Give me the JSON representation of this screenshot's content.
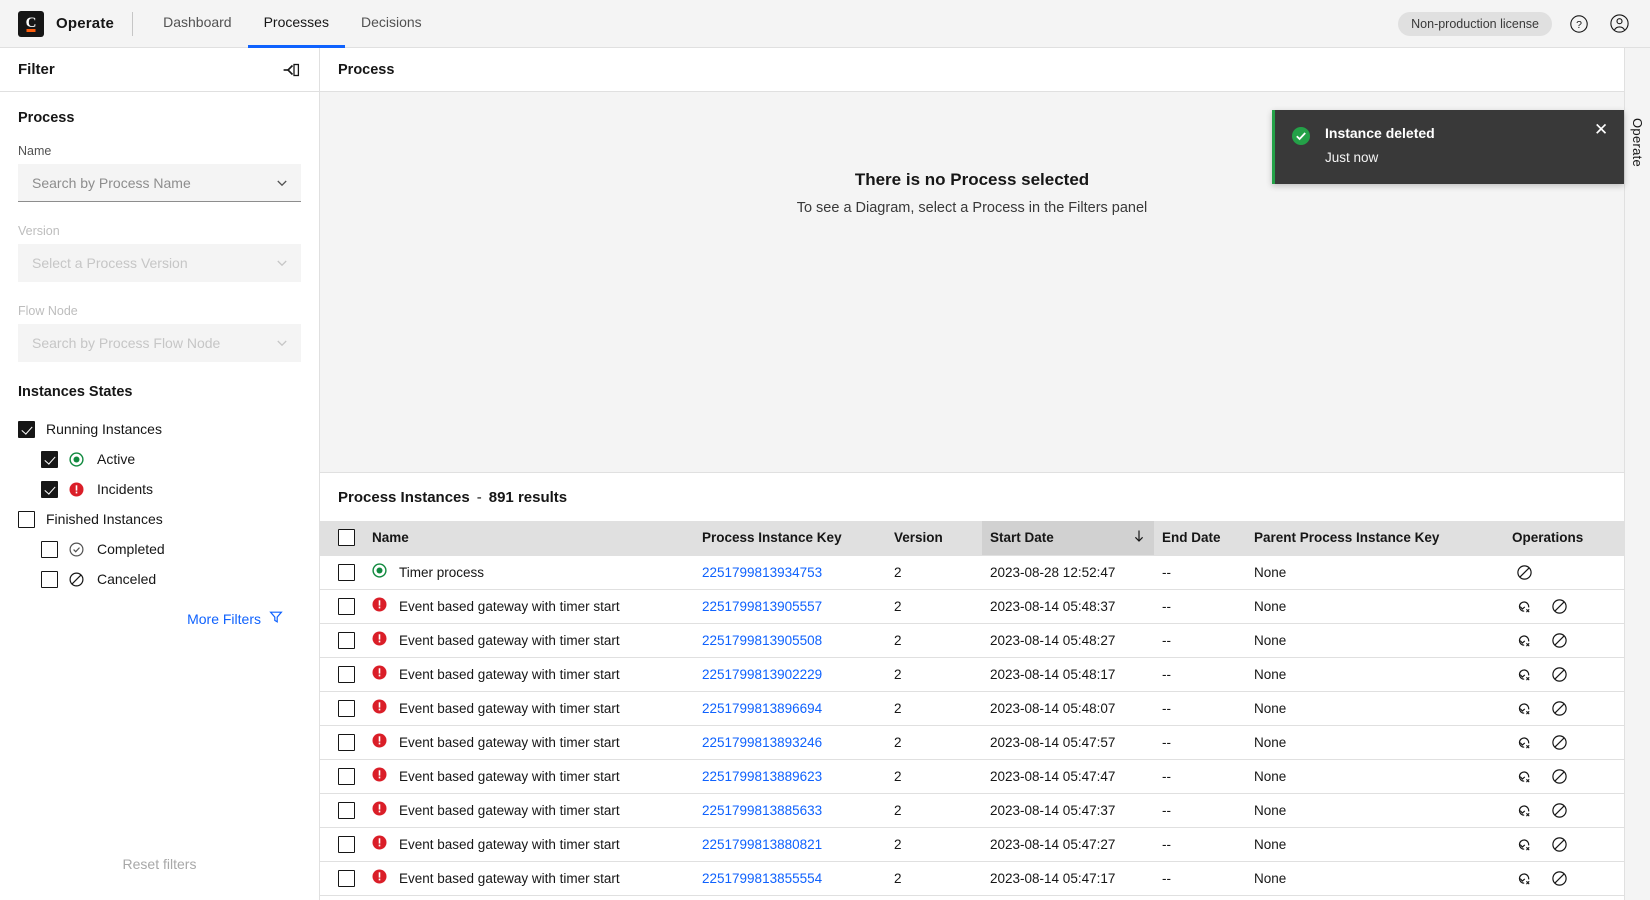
{
  "topnav": {
    "brand": "Operate",
    "logo_letter": "C",
    "tabs": [
      {
        "label": "Dashboard",
        "active": false
      },
      {
        "label": "Processes",
        "active": true
      },
      {
        "label": "Decisions",
        "active": false
      }
    ],
    "license_badge": "Non-production license",
    "help_icon": "help-circle-icon",
    "user_icon": "user-avatar-icon"
  },
  "sidebar": {
    "title": "Filter",
    "collapse_icon": "collapse-panel-icon",
    "process_section_title": "Process",
    "fields": {
      "name_label": "Name",
      "name_placeholder": "Search by Process Name",
      "version_label": "Version",
      "version_placeholder": "Select a Process Version",
      "flownode_label": "Flow Node",
      "flownode_placeholder": "Search by Process Flow Node"
    },
    "states_title": "Instances States",
    "states": [
      {
        "label": "Running Instances",
        "checked": true,
        "indent": false,
        "icon": ""
      },
      {
        "label": "Active",
        "checked": true,
        "indent": true,
        "icon": "active-icon"
      },
      {
        "label": "Incidents",
        "checked": true,
        "indent": true,
        "icon": "incident-icon"
      },
      {
        "label": "Finished Instances",
        "checked": false,
        "indent": false,
        "icon": ""
      },
      {
        "label": "Completed",
        "checked": false,
        "indent": true,
        "icon": "completed-icon"
      },
      {
        "label": "Canceled",
        "checked": false,
        "indent": true,
        "icon": "canceled-icon"
      }
    ],
    "more_filters": "More Filters",
    "more_filters_icon": "filter-funnel-icon",
    "reset_filters": "Reset filters"
  },
  "diagram": {
    "panel_title": "Process",
    "empty_title": "There is no Process selected",
    "empty_sub": "To see a Diagram, select a Process in the Filters panel"
  },
  "list": {
    "title": "Process Instances",
    "separator": "-",
    "count_label": "891 results",
    "columns": [
      "Name",
      "Process Instance Key",
      "Version",
      "Start Date",
      "End Date",
      "Parent Process Instance Key",
      "Operations"
    ],
    "sorted_column": "Start Date",
    "sort_direction_icon": "arrow-down-icon",
    "rows": [
      {
        "state": "active",
        "name": "Timer process",
        "key": "2251799813934753",
        "version": "2",
        "start": "2023-08-28 12:52:47",
        "end": "--",
        "parent": "None",
        "ops": [
          "cancel-icon"
        ]
      },
      {
        "state": "incident",
        "name": "Event based gateway with timer start",
        "key": "2251799813905557",
        "version": "2",
        "start": "2023-08-14 05:48:37",
        "end": "--",
        "parent": "None",
        "ops": [
          "retry-icon",
          "cancel-icon"
        ]
      },
      {
        "state": "incident",
        "name": "Event based gateway with timer start",
        "key": "2251799813905508",
        "version": "2",
        "start": "2023-08-14 05:48:27",
        "end": "--",
        "parent": "None",
        "ops": [
          "retry-icon",
          "cancel-icon"
        ]
      },
      {
        "state": "incident",
        "name": "Event based gateway with timer start",
        "key": "2251799813902229",
        "version": "2",
        "start": "2023-08-14 05:48:17",
        "end": "--",
        "parent": "None",
        "ops": [
          "retry-icon",
          "cancel-icon"
        ]
      },
      {
        "state": "incident",
        "name": "Event based gateway with timer start",
        "key": "2251799813896694",
        "version": "2",
        "start": "2023-08-14 05:48:07",
        "end": "--",
        "parent": "None",
        "ops": [
          "retry-icon",
          "cancel-icon"
        ]
      },
      {
        "state": "incident",
        "name": "Event based gateway with timer start",
        "key": "2251799813893246",
        "version": "2",
        "start": "2023-08-14 05:47:57",
        "end": "--",
        "parent": "None",
        "ops": [
          "retry-icon",
          "cancel-icon"
        ]
      },
      {
        "state": "incident",
        "name": "Event based gateway with timer start",
        "key": "2251799813889623",
        "version": "2",
        "start": "2023-08-14 05:47:47",
        "end": "--",
        "parent": "None",
        "ops": [
          "retry-icon",
          "cancel-icon"
        ]
      },
      {
        "state": "incident",
        "name": "Event based gateway with timer start",
        "key": "2251799813885633",
        "version": "2",
        "start": "2023-08-14 05:47:37",
        "end": "--",
        "parent": "None",
        "ops": [
          "retry-icon",
          "cancel-icon"
        ]
      },
      {
        "state": "incident",
        "name": "Event based gateway with timer start",
        "key": "2251799813880821",
        "version": "2",
        "start": "2023-08-14 05:47:27",
        "end": "--",
        "parent": "None",
        "ops": [
          "retry-icon",
          "cancel-icon"
        ]
      },
      {
        "state": "incident",
        "name": "Event based gateway with timer start",
        "key": "2251799813855554",
        "version": "2",
        "start": "2023-08-14 05:47:17",
        "end": "--",
        "parent": "None",
        "ops": [
          "retry-icon",
          "cancel-icon"
        ]
      }
    ]
  },
  "right_rail": {
    "label": "Operate"
  },
  "toast": {
    "title": "Instance deleted",
    "subtitle": "Just now",
    "status_icon": "success-check-icon",
    "close_icon": "close-icon"
  },
  "colors": {
    "accent_blue": "#0f62fe",
    "success_green": "#24a148",
    "error_red": "#da1e28",
    "toast_bg": "#393939",
    "brand_orange": "#fc5d0d"
  }
}
